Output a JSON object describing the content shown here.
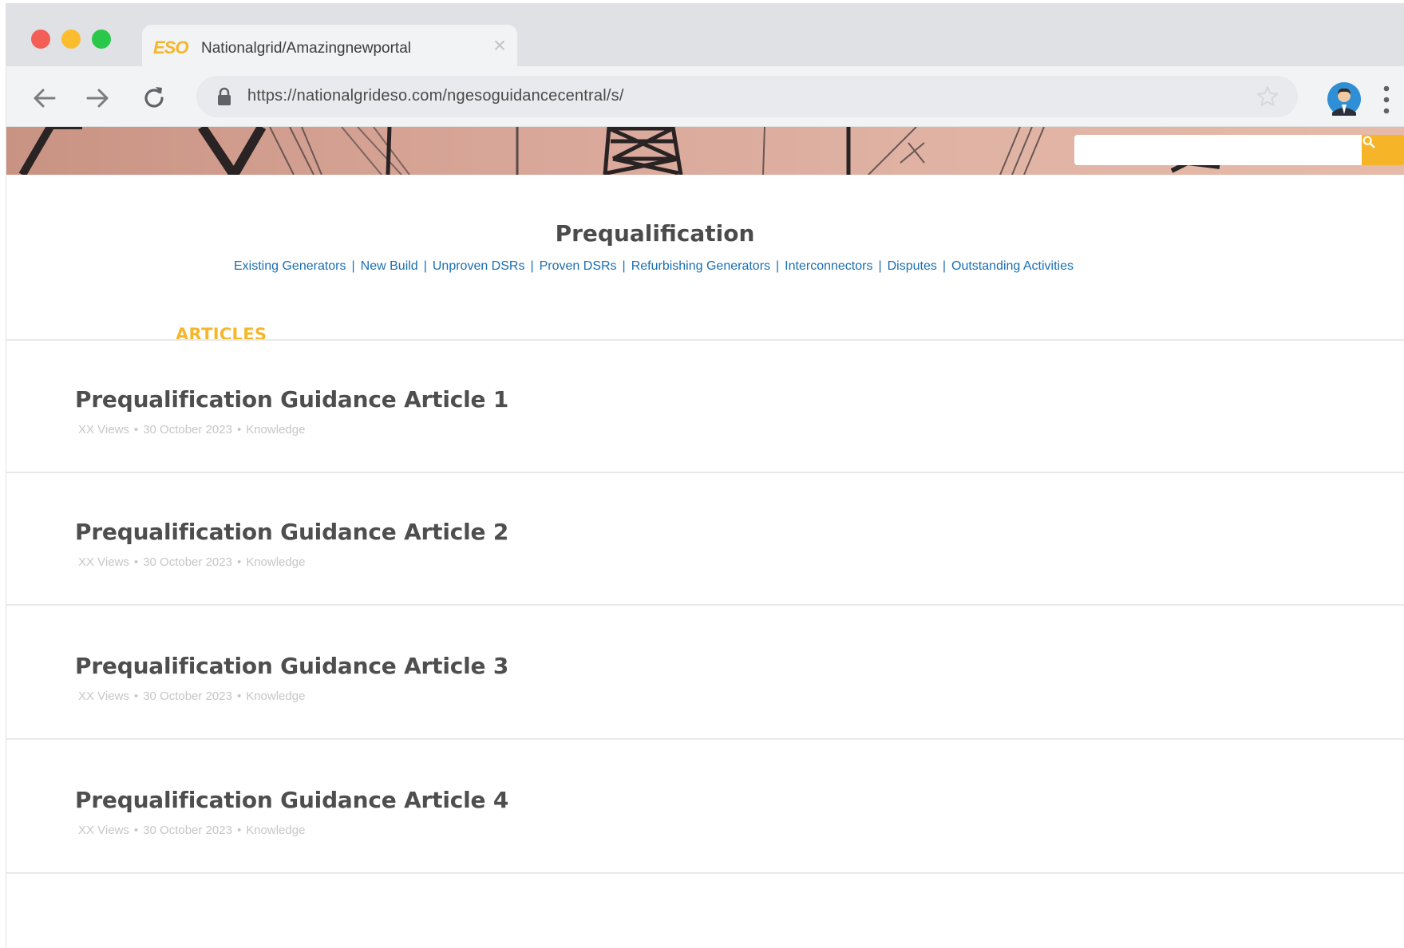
{
  "browser": {
    "tab": {
      "logo": "ESO",
      "title": "Nationalgrid/Amazingnewportal",
      "close": "×"
    },
    "url": "https://nationalgrideso.com/ngesoguidancecentral/s/"
  },
  "header": {
    "search": {
      "placeholder": ""
    }
  },
  "page": {
    "title": "Prequalification",
    "links": [
      "Existing Generators",
      "New Build",
      "Unproven DSRs",
      "Proven DSRs",
      "Refurbishing Generators",
      "Interconnectors",
      "Disputes",
      "Outstanding Activities"
    ],
    "section_heading": "ARTICLES",
    "articles": [
      {
        "title": "Prequalification Guidance Article 1",
        "views": "XX Views",
        "date": "30 October 2023",
        "category": "Knowledge"
      },
      {
        "title": "Prequalification Guidance Article 2",
        "views": "XX Views",
        "date": "30 October 2023",
        "category": "Knowledge"
      },
      {
        "title": "Prequalification Guidance Article 3",
        "views": "XX Views",
        "date": "30 October 2023",
        "category": "Knowledge"
      },
      {
        "title": "Prequalification Guidance Article 4",
        "views": "XX Views",
        "date": "30 October 2023",
        "category": "Knowledge"
      }
    ],
    "meta_separator": "•"
  },
  "colors": {
    "accent": "#f5b62a",
    "link": "#1a6fb3",
    "title_text": "#4e4e4e",
    "meta_text": "#c6c6c6"
  },
  "icons": {
    "back": "arrow-left-icon",
    "forward": "arrow-right-icon",
    "reload": "reload-icon",
    "lock": "lock-icon",
    "bookmark": "star-icon",
    "profile": "avatar",
    "menu": "kebab-menu-icon",
    "search": "search-icon"
  }
}
